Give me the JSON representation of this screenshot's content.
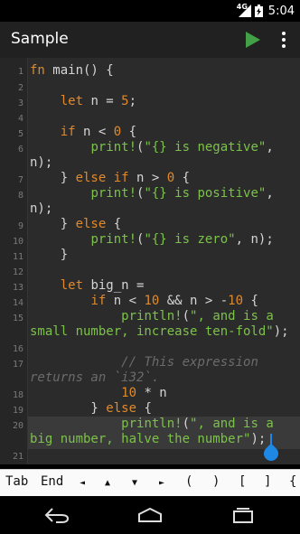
{
  "status_bar": {
    "signal_label": "4G",
    "time": "5:04"
  },
  "app_bar": {
    "title": "Sample",
    "run_icon": "play-icon",
    "menu_icon": "more-vert-icon"
  },
  "editor": {
    "gutter": [
      "1",
      "2",
      "3",
      "4",
      "5",
      "6",
      "7",
      "8",
      "9",
      "10",
      "11",
      "12",
      "13",
      "14",
      "15",
      "16",
      "17",
      "18",
      "19",
      "20",
      "21"
    ]
  },
  "keys": [
    "Tab",
    "End",
    "◄",
    "▲",
    "▼",
    "►",
    "(",
    ")",
    "[",
    "]",
    "{"
  ],
  "nav": {
    "back_icon": "back-icon",
    "home_icon": "home-icon",
    "recents_icon": "recents-icon"
  },
  "colors": {
    "keyword": "#e08a2c",
    "macro": "#7cc24a",
    "comment": "#6b6b6b",
    "accent": "#1e88e5"
  }
}
